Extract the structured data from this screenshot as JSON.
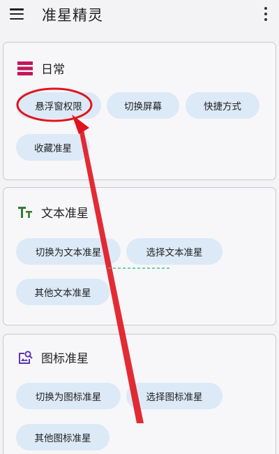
{
  "header": {
    "title": "准星精灵",
    "menu_icon": "menu-icon",
    "more_icon": "more-vert-icon"
  },
  "sections": [
    {
      "title": "日常",
      "icon": "daily-list-icon",
      "chips": [
        "悬浮窗权限",
        "切换屏幕",
        "快捷方式",
        "收藏准星"
      ]
    },
    {
      "title": "文本准星",
      "icon": "text-icon",
      "chips": [
        "切换为文本准星",
        "选择文本准星",
        "其他文本准星"
      ]
    },
    {
      "title": "图标准星",
      "icon": "image-search-icon",
      "chips": [
        "切换为图标准星",
        "选择图标准星",
        "其他图标准星"
      ]
    }
  ],
  "colors": {
    "background": "#f3f3f5",
    "chip": "#dce9f6",
    "accent_daily": "#c2185b",
    "accent_text": "#2e7d32",
    "accent_image": "#5e35b1",
    "annotation": "#e0141e"
  }
}
